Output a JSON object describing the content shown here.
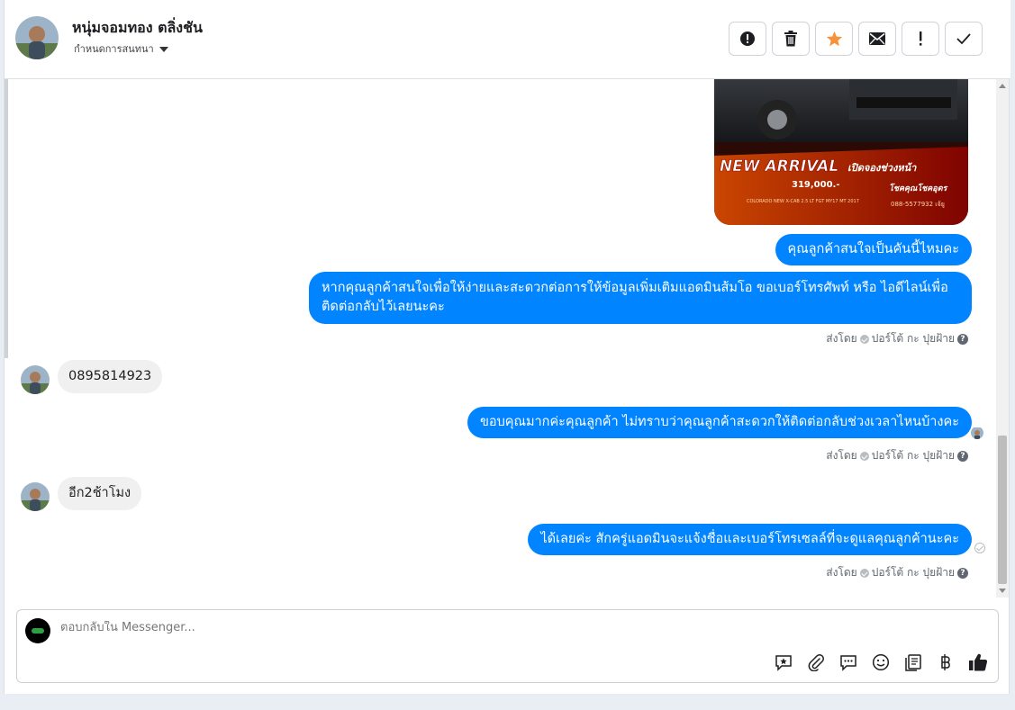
{
  "header": {
    "contact_name": "หนุ่มจอมทอง ตลิ่งชัน",
    "assign_label": "กำหนดการสนทนา",
    "actions": [
      "mark-spam",
      "delete",
      "star",
      "mark-unread",
      "important",
      "mark-done"
    ]
  },
  "car_promo": {
    "headline": "NEW ARRIVAL",
    "headline_th": "เปิดจองช่วงหน้า",
    "price": "319,000.-",
    "model": "COLORADO NEW X-CAB 2.5 LT FGT MY17 MT 2017",
    "dealer": "โชคคุณโชคอุดร",
    "phone": "088-5577932 เจ้ยู"
  },
  "messages": [
    {
      "id": "m1",
      "dir": "out",
      "text": "คุณลูกค้าสนใจเป็นคันนี้ไหมคะ"
    },
    {
      "id": "m2",
      "dir": "out",
      "text": "หากคุณลูกค้าสนใจเพื่อให้ง่ายและสะดวกต่อการให้ข้อมูลเพิ่มเติมแอดมินส้มโอ ขอเบอร์โทรศัพท์ หรือ ไอดีไลน์เพื่อติดต่อกลับไว้เลยนะคะ"
    },
    {
      "id": "m3",
      "dir": "in",
      "text": "0895814923"
    },
    {
      "id": "m4",
      "dir": "out",
      "text": "ขอบคุณมากค่ะคุณลูกค้า ไม่ทราบว่าคุณลูกค้าสะดวกให้ติดต่อกลับช่วงเวลาไหนบ้างคะ"
    },
    {
      "id": "m5",
      "dir": "in",
      "text": "อีก2ช้าโมง"
    },
    {
      "id": "m6",
      "dir": "out",
      "text": "ได้เลยค่ะ สักครู่แอดมินจะแจ้งชื่อและเบอร์โทรเซลล์ที่จะดูแลคุณลูกค้านะคะ"
    }
  ],
  "sent_by": {
    "label": "ส่งโดย",
    "agent": "ปอร์โต้ กะ ปุยฝ้าย"
  },
  "composer": {
    "placeholder": "ตอบกลับใน Messenger..."
  },
  "colors": {
    "outgoing_bubble": "#0084ff",
    "incoming_bubble": "#f0f0f0",
    "star": "#f7923a"
  }
}
